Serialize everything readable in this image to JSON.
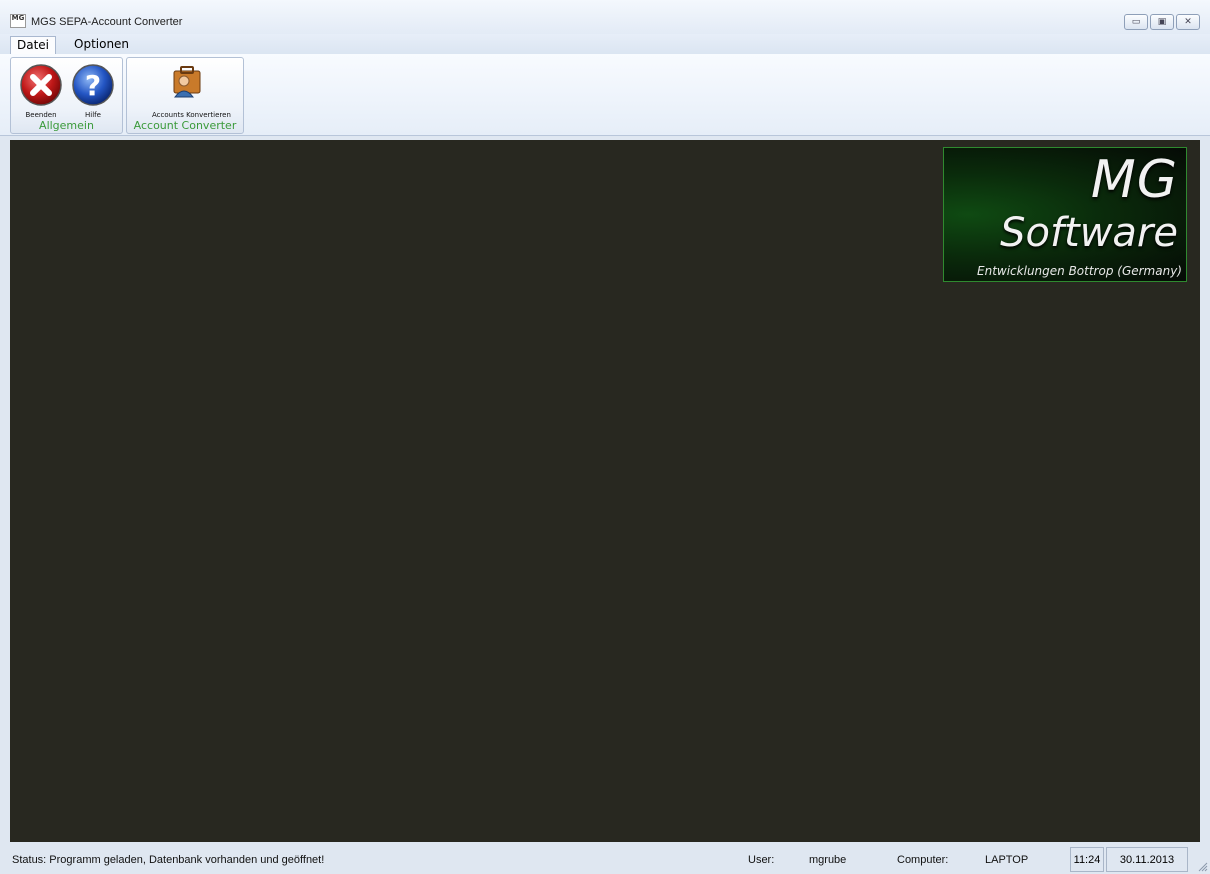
{
  "window": {
    "title": "MGS SEPA-Account Converter",
    "app_icon_text": "MG",
    "controls": {
      "minimize": "▭",
      "maximize": "▣",
      "close": "✕"
    }
  },
  "menu": {
    "tabs": [
      {
        "label": "Datei",
        "active": true
      },
      {
        "label": "Optionen",
        "active": false
      }
    ]
  },
  "ribbon": {
    "groups": [
      {
        "label": "Allgemein",
        "buttons": [
          {
            "label": "Beenden",
            "icon": "close-circle-icon"
          },
          {
            "label": "Hilfe",
            "icon": "help-circle-icon"
          }
        ]
      },
      {
        "label": "Account Converter",
        "buttons": [
          {
            "label": "Accounts Konvertieren",
            "icon": "user-briefcase-icon"
          }
        ]
      }
    ]
  },
  "logo": {
    "line1": "MG",
    "line2": "Software",
    "line3": "Entwicklungen Bottrop (Germany)"
  },
  "statusbar": {
    "status": "Status: Programm geladen, Datenbank vorhanden und geöffnet!",
    "user_label": "User:",
    "user_value": "mgrube",
    "computer_label": "Computer:",
    "computer_value": "LAPTOP",
    "time": "11:24",
    "date": "30.11.2013"
  },
  "colors": {
    "workspace": "#282820",
    "group_label": "#3a9a3a",
    "logo_border": "#2f8a2f"
  }
}
